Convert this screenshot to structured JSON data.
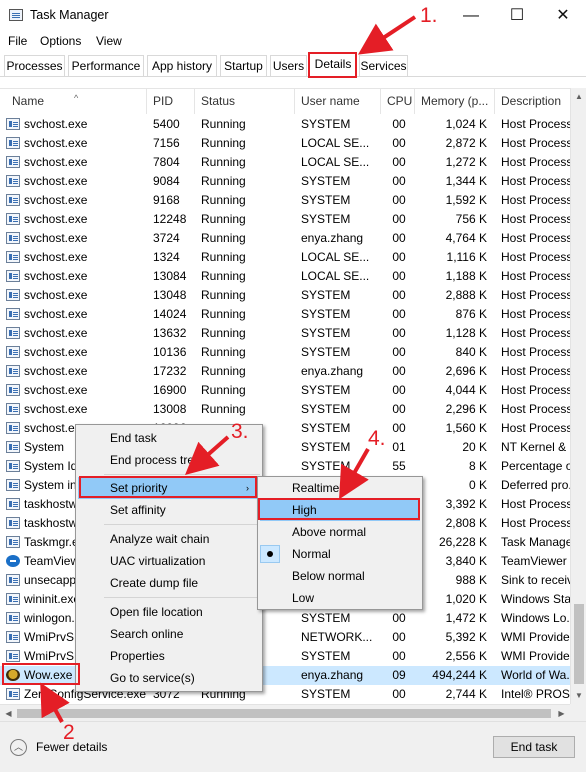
{
  "window": {
    "title": "Task Manager",
    "controls": {
      "minimize": "—",
      "maximize": "☐",
      "close": "✕"
    }
  },
  "menubar": {
    "items": [
      "File",
      "Options",
      "View"
    ]
  },
  "tabs": [
    "Processes",
    "Performance",
    "App history",
    "Startup",
    "Users",
    "Details",
    "Services"
  ],
  "active_tab": "Details",
  "columns": {
    "name": "Name",
    "pid": "PID",
    "status": "Status",
    "user": "User name",
    "cpu": "CPU",
    "memory": "Memory (p...",
    "description": "Description"
  },
  "rows": [
    {
      "name": "svchost.exe",
      "pid": "5400",
      "status": "Running",
      "user": "SYSTEM",
      "cpu": "00",
      "memory": "1,024 K",
      "description": "Host Process",
      "icon": "service-icon"
    },
    {
      "name": "svchost.exe",
      "pid": "7156",
      "status": "Running",
      "user": "LOCAL SE...",
      "cpu": "00",
      "memory": "2,872 K",
      "description": "Host Process",
      "icon": "service-icon"
    },
    {
      "name": "svchost.exe",
      "pid": "7804",
      "status": "Running",
      "user": "LOCAL SE...",
      "cpu": "00",
      "memory": "1,272 K",
      "description": "Host Process",
      "icon": "service-icon"
    },
    {
      "name": "svchost.exe",
      "pid": "9084",
      "status": "Running",
      "user": "SYSTEM",
      "cpu": "00",
      "memory": "1,344 K",
      "description": "Host Process",
      "icon": "service-icon"
    },
    {
      "name": "svchost.exe",
      "pid": "9168",
      "status": "Running",
      "user": "SYSTEM",
      "cpu": "00",
      "memory": "1,592 K",
      "description": "Host Process",
      "icon": "service-icon"
    },
    {
      "name": "svchost.exe",
      "pid": "12248",
      "status": "Running",
      "user": "SYSTEM",
      "cpu": "00",
      "memory": "756 K",
      "description": "Host Process",
      "icon": "service-icon"
    },
    {
      "name": "svchost.exe",
      "pid": "3724",
      "status": "Running",
      "user": "enya.zhang",
      "cpu": "00",
      "memory": "4,764 K",
      "description": "Host Process",
      "icon": "service-icon"
    },
    {
      "name": "svchost.exe",
      "pid": "1324",
      "status": "Running",
      "user": "LOCAL SE...",
      "cpu": "00",
      "memory": "1,116 K",
      "description": "Host Process",
      "icon": "service-icon"
    },
    {
      "name": "svchost.exe",
      "pid": "13084",
      "status": "Running",
      "user": "LOCAL SE...",
      "cpu": "00",
      "memory": "1,188 K",
      "description": "Host Process",
      "icon": "service-icon"
    },
    {
      "name": "svchost.exe",
      "pid": "13048",
      "status": "Running",
      "user": "SYSTEM",
      "cpu": "00",
      "memory": "2,888 K",
      "description": "Host Process",
      "icon": "service-icon"
    },
    {
      "name": "svchost.exe",
      "pid": "14024",
      "status": "Running",
      "user": "SYSTEM",
      "cpu": "00",
      "memory": "876 K",
      "description": "Host Process",
      "icon": "service-icon"
    },
    {
      "name": "svchost.exe",
      "pid": "13632",
      "status": "Running",
      "user": "SYSTEM",
      "cpu": "00",
      "memory": "1,128 K",
      "description": "Host Process",
      "icon": "service-icon"
    },
    {
      "name": "svchost.exe",
      "pid": "10136",
      "status": "Running",
      "user": "SYSTEM",
      "cpu": "00",
      "memory": "840 K",
      "description": "Host Process",
      "icon": "service-icon"
    },
    {
      "name": "svchost.exe",
      "pid": "17232",
      "status": "Running",
      "user": "enya.zhang",
      "cpu": "00",
      "memory": "2,696 K",
      "description": "Host Process",
      "icon": "service-icon"
    },
    {
      "name": "svchost.exe",
      "pid": "16900",
      "status": "Running",
      "user": "SYSTEM",
      "cpu": "00",
      "memory": "4,044 K",
      "description": "Host Process",
      "icon": "service-icon"
    },
    {
      "name": "svchost.exe",
      "pid": "13008",
      "status": "Running",
      "user": "SYSTEM",
      "cpu": "00",
      "memory": "2,296 K",
      "description": "Host Process",
      "icon": "service-icon"
    },
    {
      "name": "svchost.exe",
      "pid": "16096",
      "status": "",
      "user": "SYSTEM",
      "cpu": "00",
      "memory": "1,560 K",
      "description": "Host Process",
      "icon": "service-icon"
    },
    {
      "name": "System",
      "pid": "",
      "status": "",
      "user": "SYSTEM",
      "cpu": "01",
      "memory": "20 K",
      "description": "NT Kernel & ...",
      "icon": "service-icon"
    },
    {
      "name": "System Idle",
      "pid": "",
      "status": "",
      "user": "SYSTEM",
      "cpu": "55",
      "memory": "8 K",
      "description": "Percentage o...",
      "icon": "service-icon"
    },
    {
      "name": "System interrupts",
      "pid": "",
      "status": "",
      "user": "",
      "cpu": "00",
      "memory": "0 K",
      "description": "Deferred pro...",
      "icon": "service-icon"
    },
    {
      "name": "taskhostw.exe",
      "pid": "",
      "status": "",
      "user": "",
      "cpu": "00",
      "memory": "3,392 K",
      "description": "Host Process",
      "icon": "service-icon"
    },
    {
      "name": "taskhostw.exe",
      "pid": "",
      "status": "",
      "user": "",
      "cpu": "00",
      "memory": "2,808 K",
      "description": "Host Process",
      "icon": "service-icon"
    },
    {
      "name": "Taskmgr.exe",
      "pid": "",
      "status": "",
      "user": "",
      "cpu": "05",
      "memory": "26,228 K",
      "description": "Task Manage...",
      "icon": "taskmgr-icon"
    },
    {
      "name": "TeamViewer.exe",
      "pid": "",
      "status": "",
      "user": "",
      "cpu": "00",
      "memory": "3,840 K",
      "description": "TeamViewer ...",
      "icon": "teamviewer-icon"
    },
    {
      "name": "unsecapp.exe",
      "pid": "",
      "status": "",
      "user": "",
      "cpu": "00",
      "memory": "988 K",
      "description": "Sink to receiv...",
      "icon": "service-icon"
    },
    {
      "name": "wininit.exe",
      "pid": "",
      "status": "",
      "user": "",
      "cpu": "00",
      "memory": "1,020 K",
      "description": "Windows Sta...",
      "icon": "service-icon"
    },
    {
      "name": "winlogon.exe",
      "pid": "",
      "status": "",
      "user": "SYSTEM",
      "cpu": "00",
      "memory": "1,472 K",
      "description": "Windows Lo...",
      "icon": "service-icon"
    },
    {
      "name": "WmiPrvSE.exe",
      "pid": "",
      "status": "",
      "user": "NETWORK...",
      "cpu": "00",
      "memory": "5,392 K",
      "description": "WMI Provide...",
      "icon": "service-icon"
    },
    {
      "name": "WmiPrvSE.exe",
      "pid": "",
      "status": "",
      "user": "SYSTEM",
      "cpu": "00",
      "memory": "2,556 K",
      "description": "WMI Provide...",
      "icon": "service-icon"
    },
    {
      "name": "Wow.exe",
      "pid": "",
      "status": "",
      "user": "enya.zhang",
      "cpu": "09",
      "memory": "494,244 K",
      "description": "World of Wa...",
      "icon": "wow-icon",
      "selected": true
    },
    {
      "name": "ZeroConfigService.exe",
      "pid": "3072",
      "status": "Running",
      "user": "SYSTEM",
      "cpu": "00",
      "memory": "2,744 K",
      "description": "Intel® PROS...",
      "icon": "service-icon"
    }
  ],
  "context_menu": {
    "items": [
      "End task",
      "End process tree",
      "Set priority",
      "Set affinity",
      "Analyze wait chain",
      "UAC virtualization",
      "Create dump file",
      "Open file location",
      "Search online",
      "Properties",
      "Go to service(s)"
    ],
    "submenu_arrow": "›"
  },
  "priority_menu": {
    "items": [
      "Realtime",
      "High",
      "Above normal",
      "Normal",
      "Below normal",
      "Low"
    ],
    "current": "Normal"
  },
  "footer": {
    "fewer_details": "Fewer details",
    "end_task": "End task"
  },
  "annotations": {
    "step1": "1.",
    "step2": "2",
    "step3": "3.",
    "step4": "4."
  },
  "colors": {
    "annotation_red": "#e41e26",
    "selection": "#cce8ff",
    "menu_highlight": "#91c9f7"
  }
}
